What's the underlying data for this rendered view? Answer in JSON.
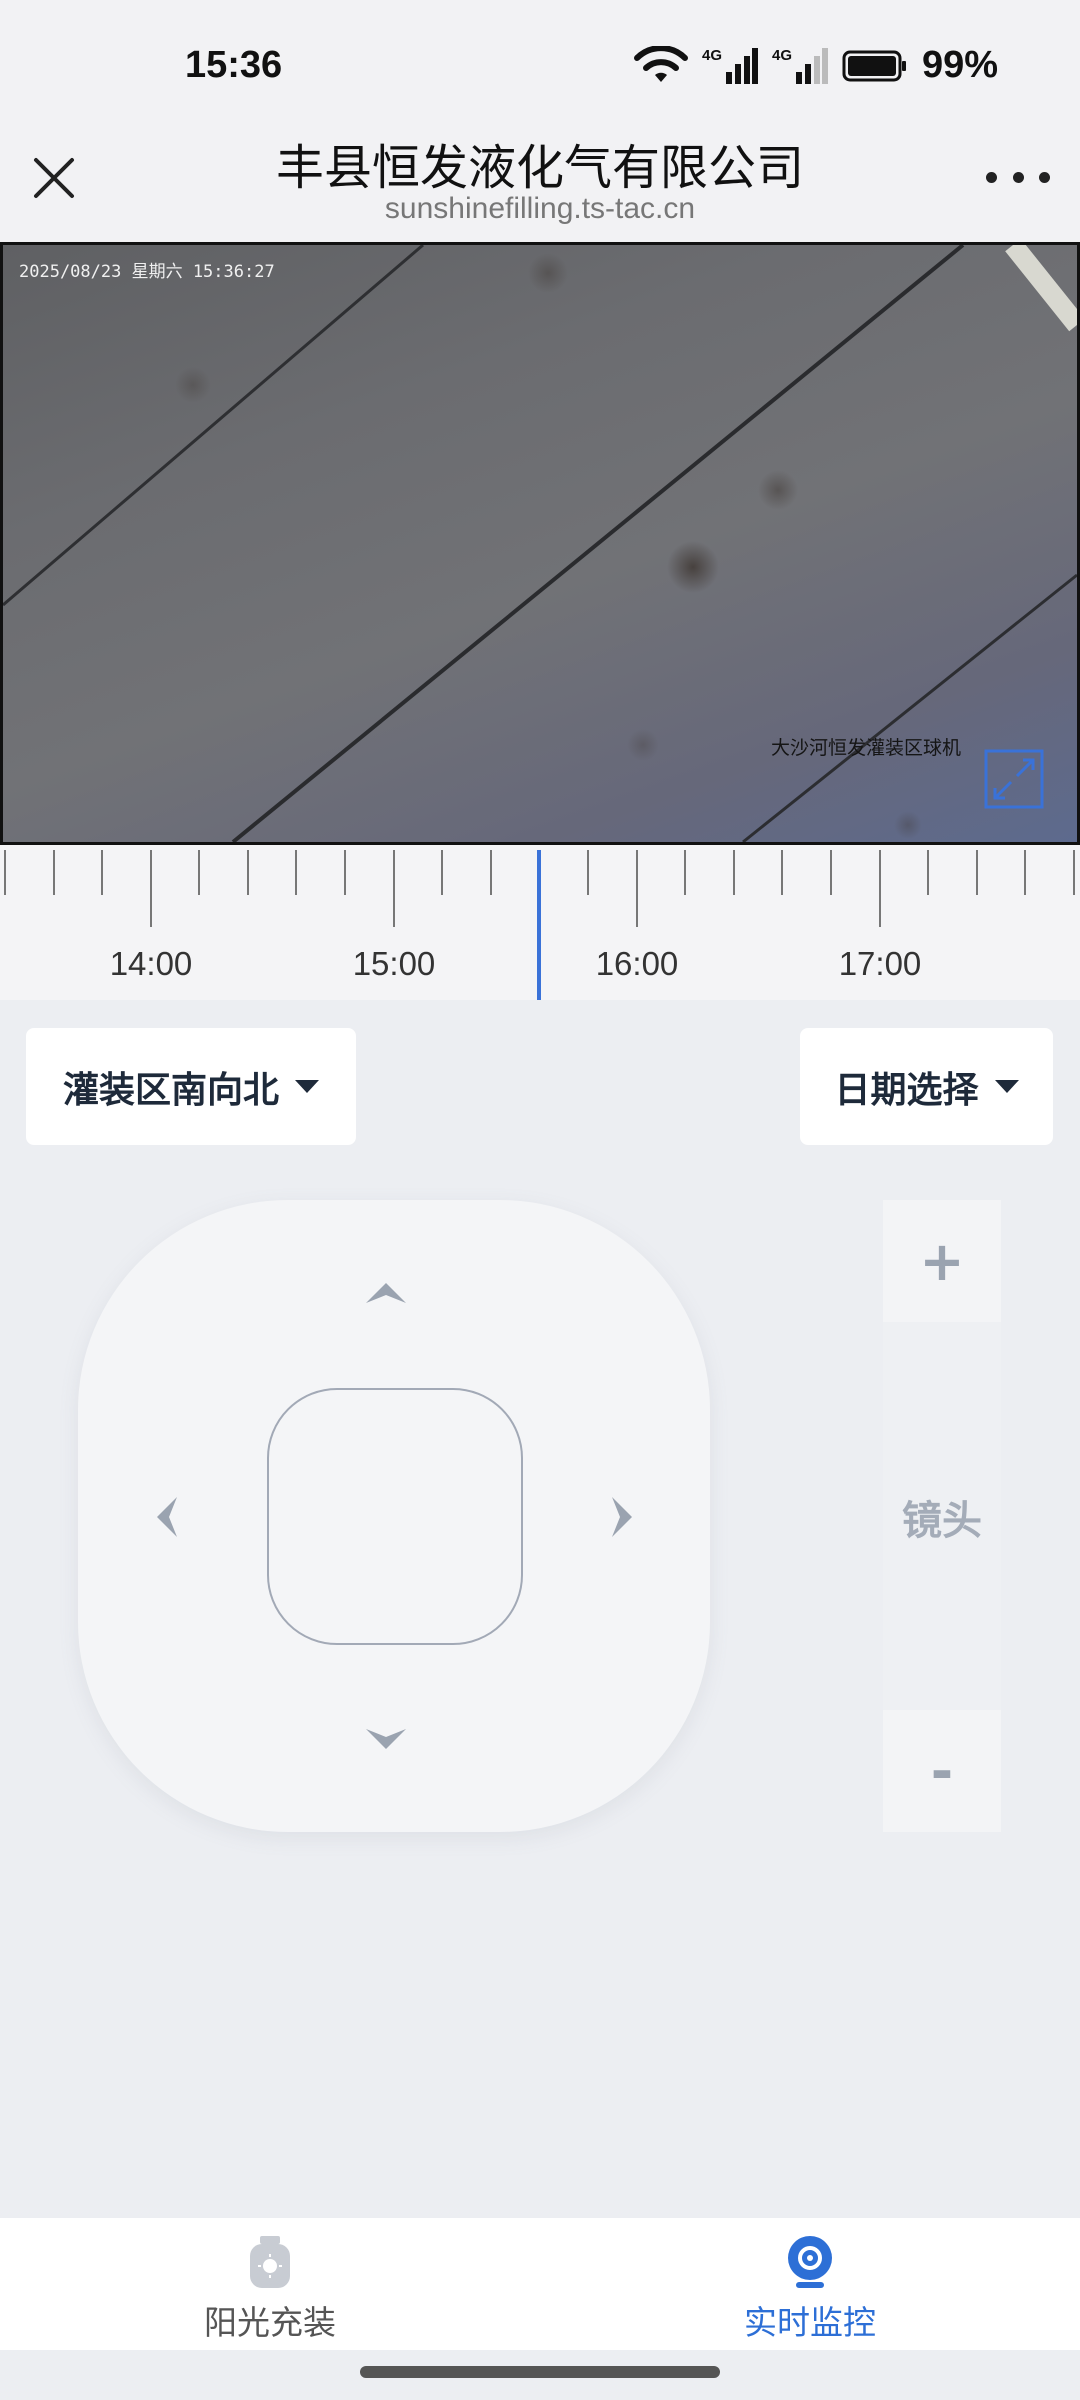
{
  "status_bar": {
    "time": "15:36",
    "battery": "99%",
    "network_1": "4G",
    "network_2": "4G"
  },
  "header": {
    "title": "丰县恒发液化气有限公司",
    "subtitle": "sunshinefilling.ts-tac.cn"
  },
  "video": {
    "timestamp": "2025/08/23 星期六 15:36:27",
    "camera_name": "大沙河恒发灌装区球机"
  },
  "timeline": {
    "labels": [
      "14:00",
      "15:00",
      "16:00",
      "17:00"
    ],
    "cursor_color": "#3a72d8"
  },
  "controls": {
    "area_select_label": "灌装区南向北",
    "date_select_label": "日期选择",
    "zoom_plus": "+",
    "zoom_label": "镜头",
    "zoom_minus": "-"
  },
  "bottom_nav": {
    "items": [
      {
        "label": "阳光充装",
        "icon": "gas-cylinder-icon",
        "active": false
      },
      {
        "label": "实时监控",
        "icon": "camera-icon",
        "active": true
      }
    ],
    "active_color": "#2d6fd6"
  }
}
